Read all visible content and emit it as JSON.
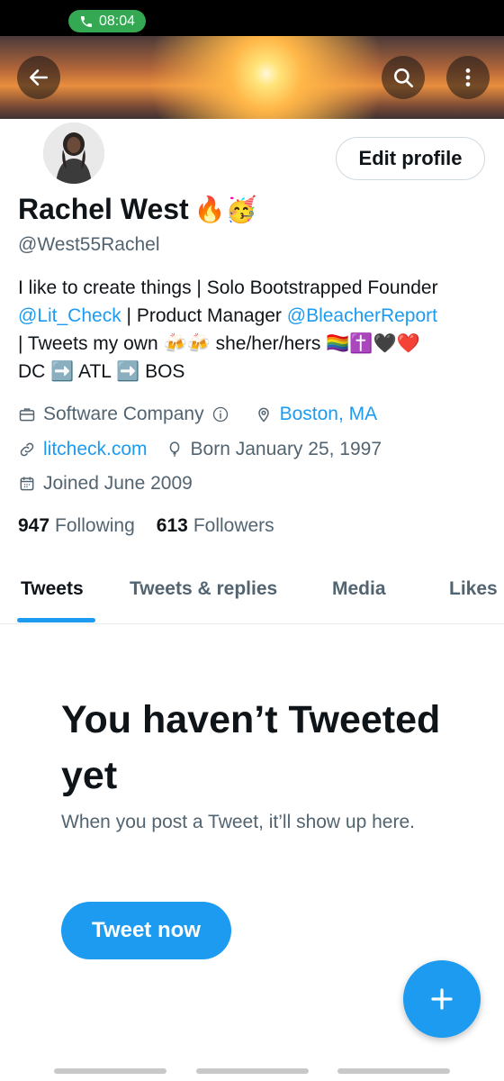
{
  "status_bar": {
    "call_time": "08:04"
  },
  "header": {
    "back_icon": "arrow-left-icon",
    "search_icon": "search-icon",
    "more_icon": "more-vertical-icon"
  },
  "profile": {
    "edit_label": "Edit profile",
    "name": "Rachel West",
    "name_emojis": "🔥🥳",
    "handle": "@West55Rachel",
    "bio": {
      "line1": "I like to create things | Solo Bootstrapped Founder",
      "mention1": "@Lit_Check",
      "line2_mid": " | Product Manager ",
      "mention2": "@BleacherReport",
      "line3_text": "| Tweets my own",
      "line3_emoji": "🍻🍻",
      "line3_pronouns": "she/her/hers",
      "line3_emojis": "🏳️‍🌈✝️🖤❤️",
      "dc": "DC",
      "arrow1": "➡️",
      "atl": "ATL",
      "arrow2": "➡️",
      "bos": "BOS"
    },
    "category": "Software Company",
    "location": "Boston, MA",
    "website": "litcheck.com",
    "born": "Born January 25, 1997",
    "joined": "Joined June 2009",
    "following_count": "947",
    "following_label": "Following",
    "followers_count": "613",
    "followers_label": "Followers"
  },
  "tabs": [
    {
      "label": "Tweets",
      "active": true
    },
    {
      "label": "Tweets & replies",
      "active": false
    },
    {
      "label": "Media",
      "active": false
    },
    {
      "label": "Likes",
      "active": false
    }
  ],
  "empty_state": {
    "title": "You haven’t Tweeted yet",
    "subtitle": "When you post a Tweet, it’ll show up here.",
    "button": "Tweet now"
  },
  "fab_icon": "plus-icon",
  "colors": {
    "accent": "#1d9bf0",
    "text": "#0f1419",
    "secondary": "#536471",
    "call_green": "#34a853"
  }
}
